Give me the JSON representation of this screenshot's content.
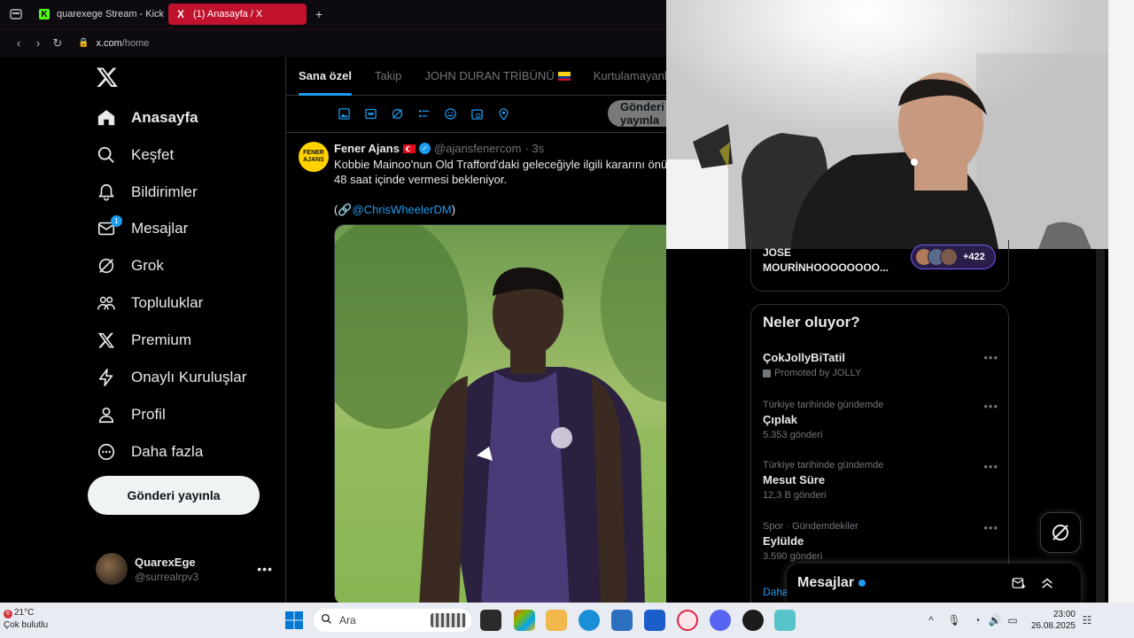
{
  "browser": {
    "tabs": [
      {
        "title": "quarexege Stream - Kick",
        "favicon": "K"
      },
      {
        "title": "(1) Anasayfa / X",
        "favicon": "X"
      }
    ],
    "url_domain": "x.com",
    "url_path": "/home"
  },
  "sidebar": {
    "items": [
      {
        "label": "Anasayfa",
        "icon": "home-icon"
      },
      {
        "label": "Keşfet",
        "icon": "search-icon"
      },
      {
        "label": "Bildirimler",
        "icon": "bell-icon"
      },
      {
        "label": "Mesajlar",
        "icon": "mail-icon",
        "badge": "1"
      },
      {
        "label": "Grok",
        "icon": "grok-icon"
      },
      {
        "label": "Topluluklar",
        "icon": "communities-icon"
      },
      {
        "label": "Premium",
        "icon": "x-icon"
      },
      {
        "label": "Onaylı Kuruluşlar",
        "icon": "lightning-icon"
      },
      {
        "label": "Profil",
        "icon": "person-icon"
      },
      {
        "label": "Daha fazla",
        "icon": "more-circle-icon"
      }
    ],
    "post_button": "Gönderi yayınla",
    "account": {
      "name": "QuarexEge",
      "handle": "@surrealrpv3"
    }
  },
  "main": {
    "tabs": [
      {
        "label": "Sana özel"
      },
      {
        "label": "Takip"
      },
      {
        "label": "JOHN DURAN TRİBÜNÜ"
      },
      {
        "label": "Kurtulamayanlar"
      }
    ],
    "composer_post": "Gönderi yayınla",
    "tweet": {
      "avatar_text": "FENER AJANS",
      "name": "Fener Ajans",
      "handle": "@ajansfenercom",
      "time": "· 3s",
      "text_line1": "Kobbie Mainoo'nun Old Trafford'daki geleceğiyle ilgili kararını önümüzdeki",
      "text_line2": "48 saat içinde vermesi bekleniyor.",
      "source_prefix": "(🔗",
      "source_link": "@ChrisWheelerDM",
      "source_suffix": ")"
    }
  },
  "right": {
    "space": {
      "title": "JOSE MOURİNHOOOOOOOO...",
      "listeners": "+422"
    },
    "trends_title": "Neler oluyor?",
    "trends": [
      {
        "context": "",
        "name": "ÇokJollyBiTatil",
        "count": "",
        "promoted": "Promoted by JOLLY"
      },
      {
        "context": "Türkiye tarihinde gündemde",
        "name": "Çıplak",
        "count": "5.353 gönderi"
      },
      {
        "context": "Türkiye tarihinde gündemde",
        "name": "Mesut Süre",
        "count": "12,3 B gönderi"
      },
      {
        "context": "Spor · Gündemdekiler",
        "name": "Eylülde",
        "count": "3.590 gönderi"
      }
    ],
    "show_more": "Daha fazla göster",
    "messages_drawer": "Mesajlar"
  },
  "taskbar": {
    "temperature": "21°C",
    "weather": "Çok bulutlu",
    "weather_badge": "6",
    "search_placeholder": "Ara",
    "time": "23:00",
    "date": "26.08.2025"
  }
}
